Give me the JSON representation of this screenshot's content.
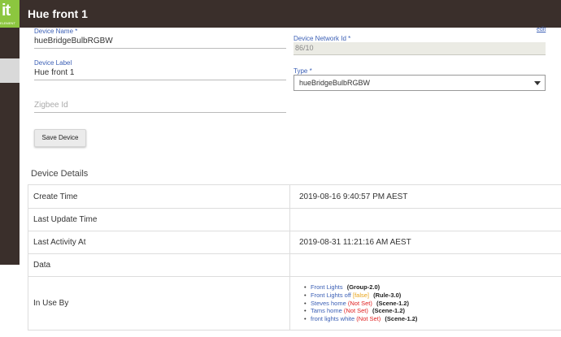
{
  "app": {
    "logo_text": "it",
    "logo_subtext": "ELEMENT"
  },
  "header": {
    "title": "Hue front 1"
  },
  "form": {
    "device_name": {
      "label": "Device Name *",
      "value": "hueBridgeBulbRGBW"
    },
    "device_network_id": {
      "label": "Device Network Id *",
      "value": "86/10",
      "edit_label": "edit"
    },
    "device_label": {
      "label": "Device Label",
      "value": "Hue front 1"
    },
    "type": {
      "label": "Type *",
      "value": "hueBridgeBulbRGBW"
    },
    "zigbee_id": {
      "placeholder": "Zigbee Id"
    },
    "save_label": "Save Device"
  },
  "details": {
    "title": "Device Details",
    "rows": [
      {
        "label": "Create Time",
        "value": "2019-08-16 9:40:57 PM AEST"
      },
      {
        "label": "Last Update Time",
        "value": ""
      },
      {
        "label": "Last Activity At",
        "value": "2019-08-31 11:21:16 AM AEST"
      },
      {
        "label": "Data",
        "value": ""
      },
      {
        "label": "In Use By"
      }
    ],
    "in_use_by": [
      {
        "name": "Front Lights",
        "status": "",
        "type": "(Group-2.0)"
      },
      {
        "name": "Front Lights off",
        "status": "[false]",
        "type": "(Rule-3.0)"
      },
      {
        "name": "Steves home",
        "status": "(Not Set)",
        "type": "(Scene-1.2)"
      },
      {
        "name": "Tams home",
        "status": "(Not Set)",
        "type": "(Scene-1.2)"
      },
      {
        "name": "front lights white",
        "status": "(Not Set)",
        "type": "(Scene-1.2)"
      }
    ]
  },
  "colors": {
    "header_bg": "#3a2f2b",
    "logo_green": "#8cc63f",
    "label_blue": "#3b5fb5",
    "status_red": "#e02020",
    "status_orange": "#e8a317"
  }
}
